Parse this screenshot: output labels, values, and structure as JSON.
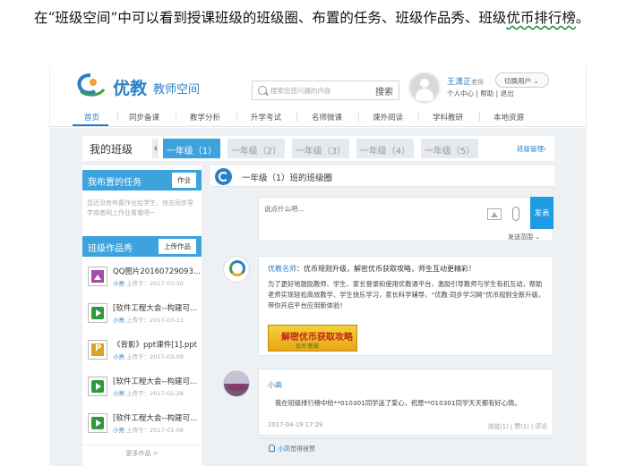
{
  "doc": {
    "paragraph_main": "在“班级空间”中可以看到授课班级的班级圈、布置的任务、班级作品秀、班级",
    "paragraph_wavy": "优币排行榜",
    "paragraph_end": "。"
  },
  "header": {
    "logo_text": "优教",
    "logo_sub": "教师空间",
    "search_placeholder": "搜索您感兴趣的内容",
    "search_button": "搜索",
    "user_name": "王潇正",
    "user_role": "老师",
    "user_links": "个人中心 | 帮助 | 退出",
    "switch_user": "切换用户 ⌄"
  },
  "nav": {
    "items": [
      "首页",
      "同步备课",
      "教学分析",
      "升学考试",
      "名师微课",
      "课外阅读",
      "学科教研",
      "本地资源"
    ],
    "active_index": 0
  },
  "classbar": {
    "title": "我的班级",
    "tabs": [
      "一年级（1）",
      "一年级（2）",
      "一年级（3）",
      "一年级（4）",
      "一年级（5）"
    ],
    "active_index": 0,
    "manage": "班级管理›"
  },
  "tasks": {
    "heading": "我布置的任务",
    "button": "作业",
    "empty": "您还没有布置作业给学生，快去同步导学或者网上作业看看吧~"
  },
  "works": {
    "heading": "班级作品秀",
    "button": "上传作品",
    "items": [
      {
        "icon": "image-file-icon",
        "title": "QQ图片20160729093...",
        "who": "小亮",
        "meta": " 上传于：2017-03-30"
      },
      {
        "icon": "video-file-icon",
        "title": "[软件工程大会--构建可...",
        "who": "小亮",
        "meta": " 上传于：2017-03-13"
      },
      {
        "icon": "ppt-file-icon",
        "title": "《背影》ppt课件[1].ppt",
        "who": "小亮",
        "meta": " 上传于：2017-03-09"
      },
      {
        "icon": "video-file-icon",
        "title": "[软件工程大会--构建可...",
        "who": "小亮",
        "meta": " 上传于：2017-02-28"
      },
      {
        "icon": "video-file-icon",
        "title": "[软件工程大会--构建可...",
        "who": "小亮",
        "meta": " 上传于：2017-01-06"
      }
    ],
    "more": "更多作品 >"
  },
  "circle": {
    "title": "一年级（1）班的班级圈",
    "post_placeholder": "说点什么吧...",
    "send": "发表",
    "scope": "发送范围 ⌄"
  },
  "feed": {
    "post1": {
      "author": "优教名师",
      "headline": "：优币规则升级，解密优币获取攻略，师生互动更精彩！",
      "body": "为了更好地鼓励教师、学生、家长登录和使用优教通平台，激励引导教师与学生有机互动，帮助老师实现轻松高效教学、学生快乐学习，家长科学辅导，“优教·同步学习网”优币规则全新升级，带你开启平台应用新体验！",
      "banner_title": "解密优币获取攻略",
      "banner_sub": "优币·新规"
    },
    "post2": {
      "author": "小高",
      "body": "我在班级排行榜中给**010301同学送了爱心，祝愿**010301同学天天都有好心情。",
      "time": "2017-04-19 17:29",
      "actions": "浏览(1) | 赞(1) | 评论",
      "likes_who": "小高",
      "likes_text": "觉得很赞"
    }
  }
}
